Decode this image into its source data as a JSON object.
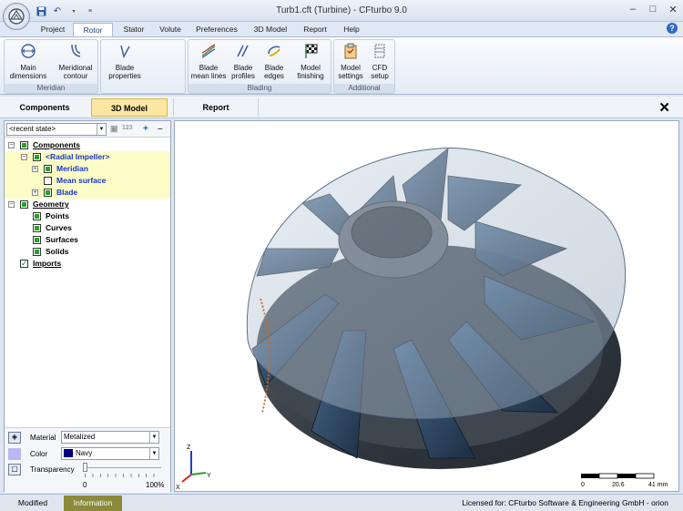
{
  "window": {
    "title": "Turb1.cft (Turbine) - CFturbo 9.0",
    "controls": [
      "–",
      "□",
      "✕"
    ]
  },
  "menu": {
    "tabs": [
      "Project",
      "Rotor",
      "Stator",
      "Volute",
      "Preferences",
      "3D Model",
      "Report",
      "Help"
    ],
    "active": "Rotor"
  },
  "ribbon": {
    "groups": [
      {
        "label": "Meridian",
        "buttons": [
          {
            "line1": "Main",
            "line2": "dimensions"
          },
          {
            "line1": "Meridional",
            "line2": "contour"
          }
        ]
      },
      {
        "label": "",
        "buttons": [
          {
            "line1": "Blade",
            "line2": "properties"
          }
        ]
      },
      {
        "label": "Blading",
        "buttons": [
          {
            "line1": "Blade",
            "line2": "mean lines"
          },
          {
            "line1": "Blade",
            "line2": "profiles"
          },
          {
            "line1": "Blade",
            "line2": "edges"
          },
          {
            "line1": "Model",
            "line2": "finishing"
          }
        ]
      },
      {
        "label": "Additional",
        "buttons": [
          {
            "line1": "Model",
            "line2": "settings"
          },
          {
            "line1": "CFD",
            "line2": "setup"
          }
        ]
      }
    ]
  },
  "panel_tabs": [
    "Components",
    "3D Model",
    "Report"
  ],
  "tree": {
    "state": "<recent state>",
    "state_counter": "123",
    "items": [
      {
        "label": "Components",
        "level": 0,
        "highlight": false,
        "underline": true
      },
      {
        "label": "<Radial Impeller>",
        "level": 1,
        "highlight": true,
        "blue": true
      },
      {
        "label": "Meridian",
        "level": 2,
        "highlight": true,
        "blue": true
      },
      {
        "label": "Mean surface",
        "level": 2,
        "highlight": true,
        "blue": true
      },
      {
        "label": "Blade",
        "level": 2,
        "highlight": true,
        "blue": true
      },
      {
        "label": "Geometry",
        "level": 0,
        "highlight": false,
        "underline": true
      },
      {
        "label": "Points",
        "level": 1,
        "highlight": false
      },
      {
        "label": "Curves",
        "level": 1,
        "highlight": false
      },
      {
        "label": "Surfaces",
        "level": 1,
        "highlight": false
      },
      {
        "label": "Solids",
        "level": 1,
        "highlight": false
      },
      {
        "label": "Imports",
        "level": 0,
        "highlight": false,
        "underline": true
      }
    ]
  },
  "properties": {
    "material_label": "Material",
    "material_value": "Metalized",
    "color_label": "Color",
    "color_value": "Navy",
    "color_swatch": "#000080",
    "transparency_label": "Transparency",
    "transparency_min": "0",
    "transparency_max": "100%",
    "transparency_value": 0.0
  },
  "viewport": {
    "scale_labels": [
      "0",
      "20.6",
      "41 mm"
    ],
    "axes": {
      "x": "X",
      "y": "Y",
      "z": "Z"
    }
  },
  "statusbar": {
    "tabs": [
      "Modified",
      "Information"
    ],
    "license": "Licensed for: CFturbo Software & Engineering GmbH - orion"
  }
}
